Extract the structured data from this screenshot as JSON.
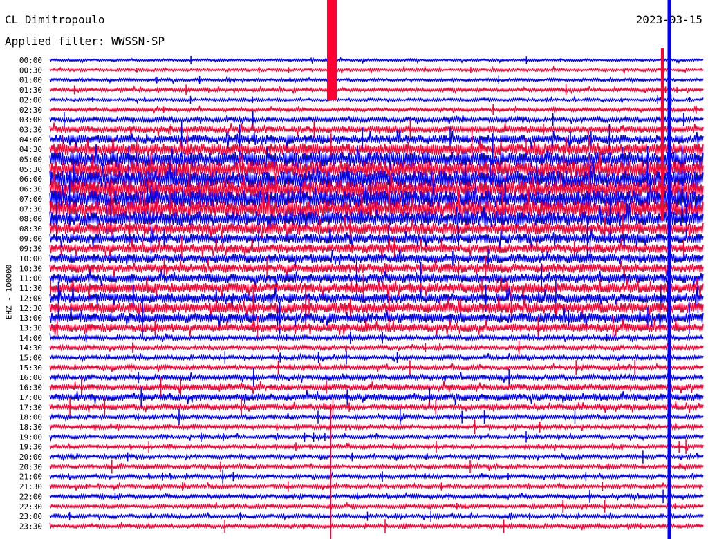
{
  "header": {
    "station": "CL Dimitropoulo",
    "filter": "Applied filter: WWSSN-SP",
    "date": "2023-03-15"
  },
  "chart_data": {
    "type": "line",
    "channel_label": "EHZ - 100000",
    "rows": [
      "00:00",
      "00:30",
      "01:00",
      "01:30",
      "02:00",
      "02:30",
      "03:00",
      "03:30",
      "04:00",
      "04:30",
      "05:00",
      "05:30",
      "06:00",
      "06:30",
      "07:00",
      "07:30",
      "08:00",
      "08:30",
      "09:00",
      "09:30",
      "10:00",
      "10:30",
      "11:00",
      "11:30",
      "12:00",
      "12:30",
      "13:00",
      "13:30",
      "14:00",
      "14:30",
      "15:00",
      "15:30",
      "16:00",
      "16:30",
      "17:00",
      "17:30",
      "18:00",
      "18:30",
      "19:00",
      "19:30",
      "20:00",
      "20:30",
      "21:00",
      "21:30",
      "22:00",
      "22:30",
      "23:00",
      "23:30"
    ],
    "row_colors": [
      "#0000ff",
      "#ff0033"
    ],
    "relative_amplitude": [
      0.25,
      0.3,
      0.3,
      0.35,
      0.3,
      0.35,
      0.5,
      0.7,
      1.0,
      1.3,
      1.6,
      1.8,
      1.9,
      1.9,
      1.9,
      1.8,
      1.6,
      1.3,
      1.1,
      1.0,
      1.0,
      1.0,
      1.0,
      1.1,
      1.1,
      1.2,
      1.1,
      0.9,
      0.5,
      0.45,
      0.45,
      0.45,
      0.55,
      0.7,
      0.8,
      0.6,
      0.45,
      0.45,
      0.4,
      0.4,
      0.4,
      0.4,
      0.4,
      0.4,
      0.4,
      0.4,
      0.4,
      0.4
    ]
  }
}
